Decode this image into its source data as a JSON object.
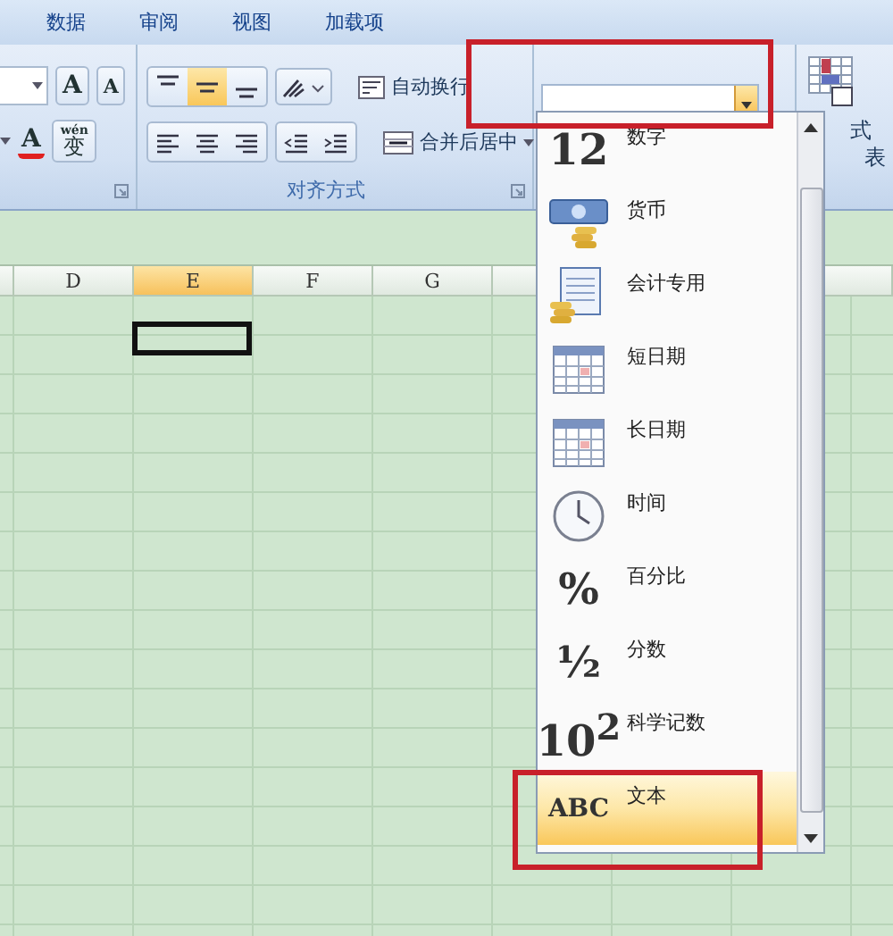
{
  "ribbon_tabs": [
    {
      "label": "数据"
    },
    {
      "label": "审阅"
    },
    {
      "label": "视图"
    },
    {
      "label": "加载项"
    }
  ],
  "font_group": {
    "buttons": [
      {
        "kind": "grow",
        "label": "A"
      },
      {
        "kind": "shrink",
        "label": "A"
      }
    ],
    "font_color_label": "A",
    "phonetic_label": "wén",
    "phonetic_char": "变"
  },
  "alignment_group": {
    "label": "对齐方式",
    "vertical_align": [
      {
        "kind": "top",
        "selected": false
      },
      {
        "kind": "middle",
        "selected": true
      },
      {
        "kind": "bottom",
        "selected": false
      }
    ],
    "wrap_text": "自动换行",
    "merge_center": "合并后居中"
  },
  "number_format": {
    "items": [
      {
        "kind": "glyph",
        "glyph": "12",
        "label": "数字",
        "selected": false
      },
      {
        "kind": "currency",
        "label": "货币",
        "selected": false
      },
      {
        "kind": "accounting",
        "label": "会计专用",
        "selected": false
      },
      {
        "kind": "calendar",
        "label": "短日期",
        "selected": false
      },
      {
        "kind": "calendar",
        "label": "长日期",
        "selected": false
      },
      {
        "kind": "clock",
        "label": "时间",
        "selected": false
      },
      {
        "kind": "glyph",
        "glyph": "%",
        "label": "百分比",
        "selected": false
      },
      {
        "kind": "glyph",
        "glyph": "½",
        "label": "分数",
        "selected": false
      },
      {
        "kind": "glyph",
        "glyph": "10$^{2}$",
        "label": "科学记数",
        "selected": false
      },
      {
        "kind": "glyph",
        "glyph": "ABC",
        "label": "文本",
        "selected": true
      }
    ]
  },
  "styles_group": {
    "texts": [
      "式",
      "表"
    ]
  },
  "sheet": {
    "columns": [
      {
        "label": "D",
        "selected": false
      },
      {
        "label": "E",
        "selected": true
      },
      {
        "label": "F",
        "selected": false
      },
      {
        "label": "G",
        "selected": false
      }
    ]
  }
}
